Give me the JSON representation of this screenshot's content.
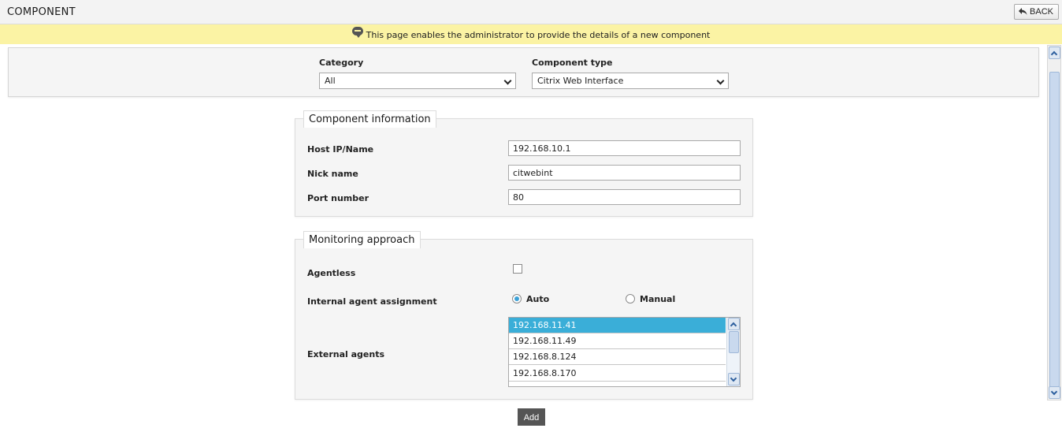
{
  "header": {
    "title": "COMPONENT",
    "back_label": "BACK"
  },
  "info": {
    "message": "This page enables the administrator to provide the details of a new component"
  },
  "filters": {
    "category_label": "Category",
    "category_value": "All",
    "component_type_label": "Component type",
    "component_type_value": "Citrix Web Interface"
  },
  "component_information": {
    "legend": "Component information",
    "host_label": "Host IP/Name",
    "host_value": "192.168.10.1",
    "nick_label": "Nick name",
    "nick_value": "citwebint",
    "port_label": "Port number",
    "port_value": "80"
  },
  "monitoring": {
    "legend": "Monitoring approach",
    "agentless_label": "Agentless",
    "agentless_checked": false,
    "internal_label": "Internal agent assignment",
    "auto_label": "Auto",
    "manual_label": "Manual",
    "selected_assignment": "Auto",
    "external_label": "External agents",
    "external_agents": [
      "192.168.11.41",
      "192.168.11.49",
      "192.168.8.124",
      "192.168.8.170"
    ],
    "selected_agent": "192.168.11.41"
  },
  "actions": {
    "add_label": "Add"
  },
  "colors": {
    "info_bar": "#fbf3a4",
    "selected_item": "#3aaed8",
    "add_button": "#555555"
  }
}
